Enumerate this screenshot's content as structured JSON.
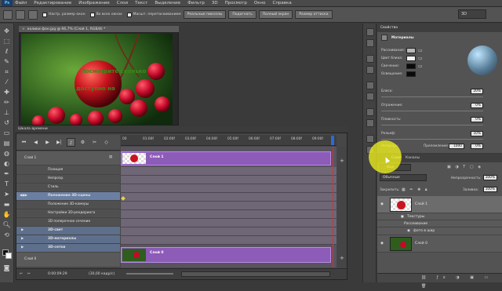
{
  "app": {
    "logo": "Ps"
  },
  "menu": [
    "Файл",
    "Редактирование",
    "Изображение",
    "Слои",
    "Текст",
    "Выделение",
    "Фильтр",
    "3D",
    "Просмотр",
    "Окно",
    "Справка"
  ],
  "options": {
    "check1": "Настр. размер окон",
    "check2": "Во всех окнах",
    "check3": "Масшт. перетаскиванием",
    "btn1": "Реальные пикселы",
    "btn2": "Подогнать",
    "btn3": "Полный экран",
    "btn4": "Размер оттиска",
    "workspace": "3D"
  },
  "document": {
    "tab_title": "колики фон.jpg @ 66,7% (Слой 1, RGB/8) *",
    "sphere_text_top": "Посмотрите сколько",
    "sphere_text_mid": "доступно на"
  },
  "timeline": {
    "title": "Шкала времени",
    "ticks": [
      "00",
      "01:00f",
      "02:00f",
      "03:00f",
      "04:00f",
      "05:00f",
      "06:00f",
      "07:00f",
      "08:00f",
      "09:00f"
    ],
    "rows": [
      {
        "label": "Слой 1",
        "kind": "layer"
      },
      {
        "label": "Позиция",
        "kind": "prop"
      },
      {
        "label": "Непрозр.",
        "kind": "prop"
      },
      {
        "label": "Стиль",
        "kind": "prop"
      },
      {
        "label": "Положение 3D-сцены",
        "kind": "sel"
      },
      {
        "label": "Положение 3D-камеры",
        "kind": "prop"
      },
      {
        "label": "Настройки 3D-рендеринга",
        "kind": "prop"
      },
      {
        "label": "3D поперечное сечение",
        "kind": "prop"
      },
      {
        "label": "3D-свет",
        "kind": "group"
      },
      {
        "label": "3D-материалы",
        "kind": "group"
      },
      {
        "label": "3D-сетки",
        "kind": "group"
      },
      {
        "label": "Слой 0",
        "kind": "layer"
      }
    ],
    "clip1_label": "Слой 1",
    "clip2_label": "Слой 0",
    "time_readout": "0:00:09:29",
    "fps": "(30,00 кадр/с)"
  },
  "properties": {
    "tab": "Свойства",
    "section": "Материалы",
    "labels": {
      "diffuse": "Рассеивание:",
      "specular": "Цвет блика:",
      "illum": "Свечение:",
      "ambient": "Освещение:",
      "shine": "Блеск:",
      "reflect": "Отражение:",
      "rough": "Плавность:",
      "opacity": "Непрозр.:",
      "relief": "Рельеф:",
      "refract": "Преломление:"
    },
    "values": {
      "shine": "20%",
      "reflect": "0%",
      "rough": "0%",
      "opacity": "0%",
      "relief": "10%",
      "refract": "1000"
    },
    "colors": {
      "diffuse": "#b8b8b8",
      "specular": "#f0f0f0",
      "illum": "#0a0a0a",
      "ambient": "#0a0a0a"
    }
  },
  "layers": {
    "tab1": "Слои",
    "tab2": "Каналы",
    "filter_label": "Вид",
    "blend": "Обычные",
    "opacity_label": "Непрозрачность:",
    "opacity": "100%",
    "lock_label": "Закрепить:",
    "fill_label": "Заливка:",
    "fill": "100%",
    "items": [
      {
        "name": "Слой 1",
        "kind": "layer"
      },
      {
        "name": "Текстуры",
        "kind": "sub"
      },
      {
        "name": "Рассеивание",
        "kind": "subsub"
      },
      {
        "name": "фото в шар",
        "kind": "subsubsub"
      },
      {
        "name": "Слой 0",
        "kind": "layer"
      }
    ]
  }
}
